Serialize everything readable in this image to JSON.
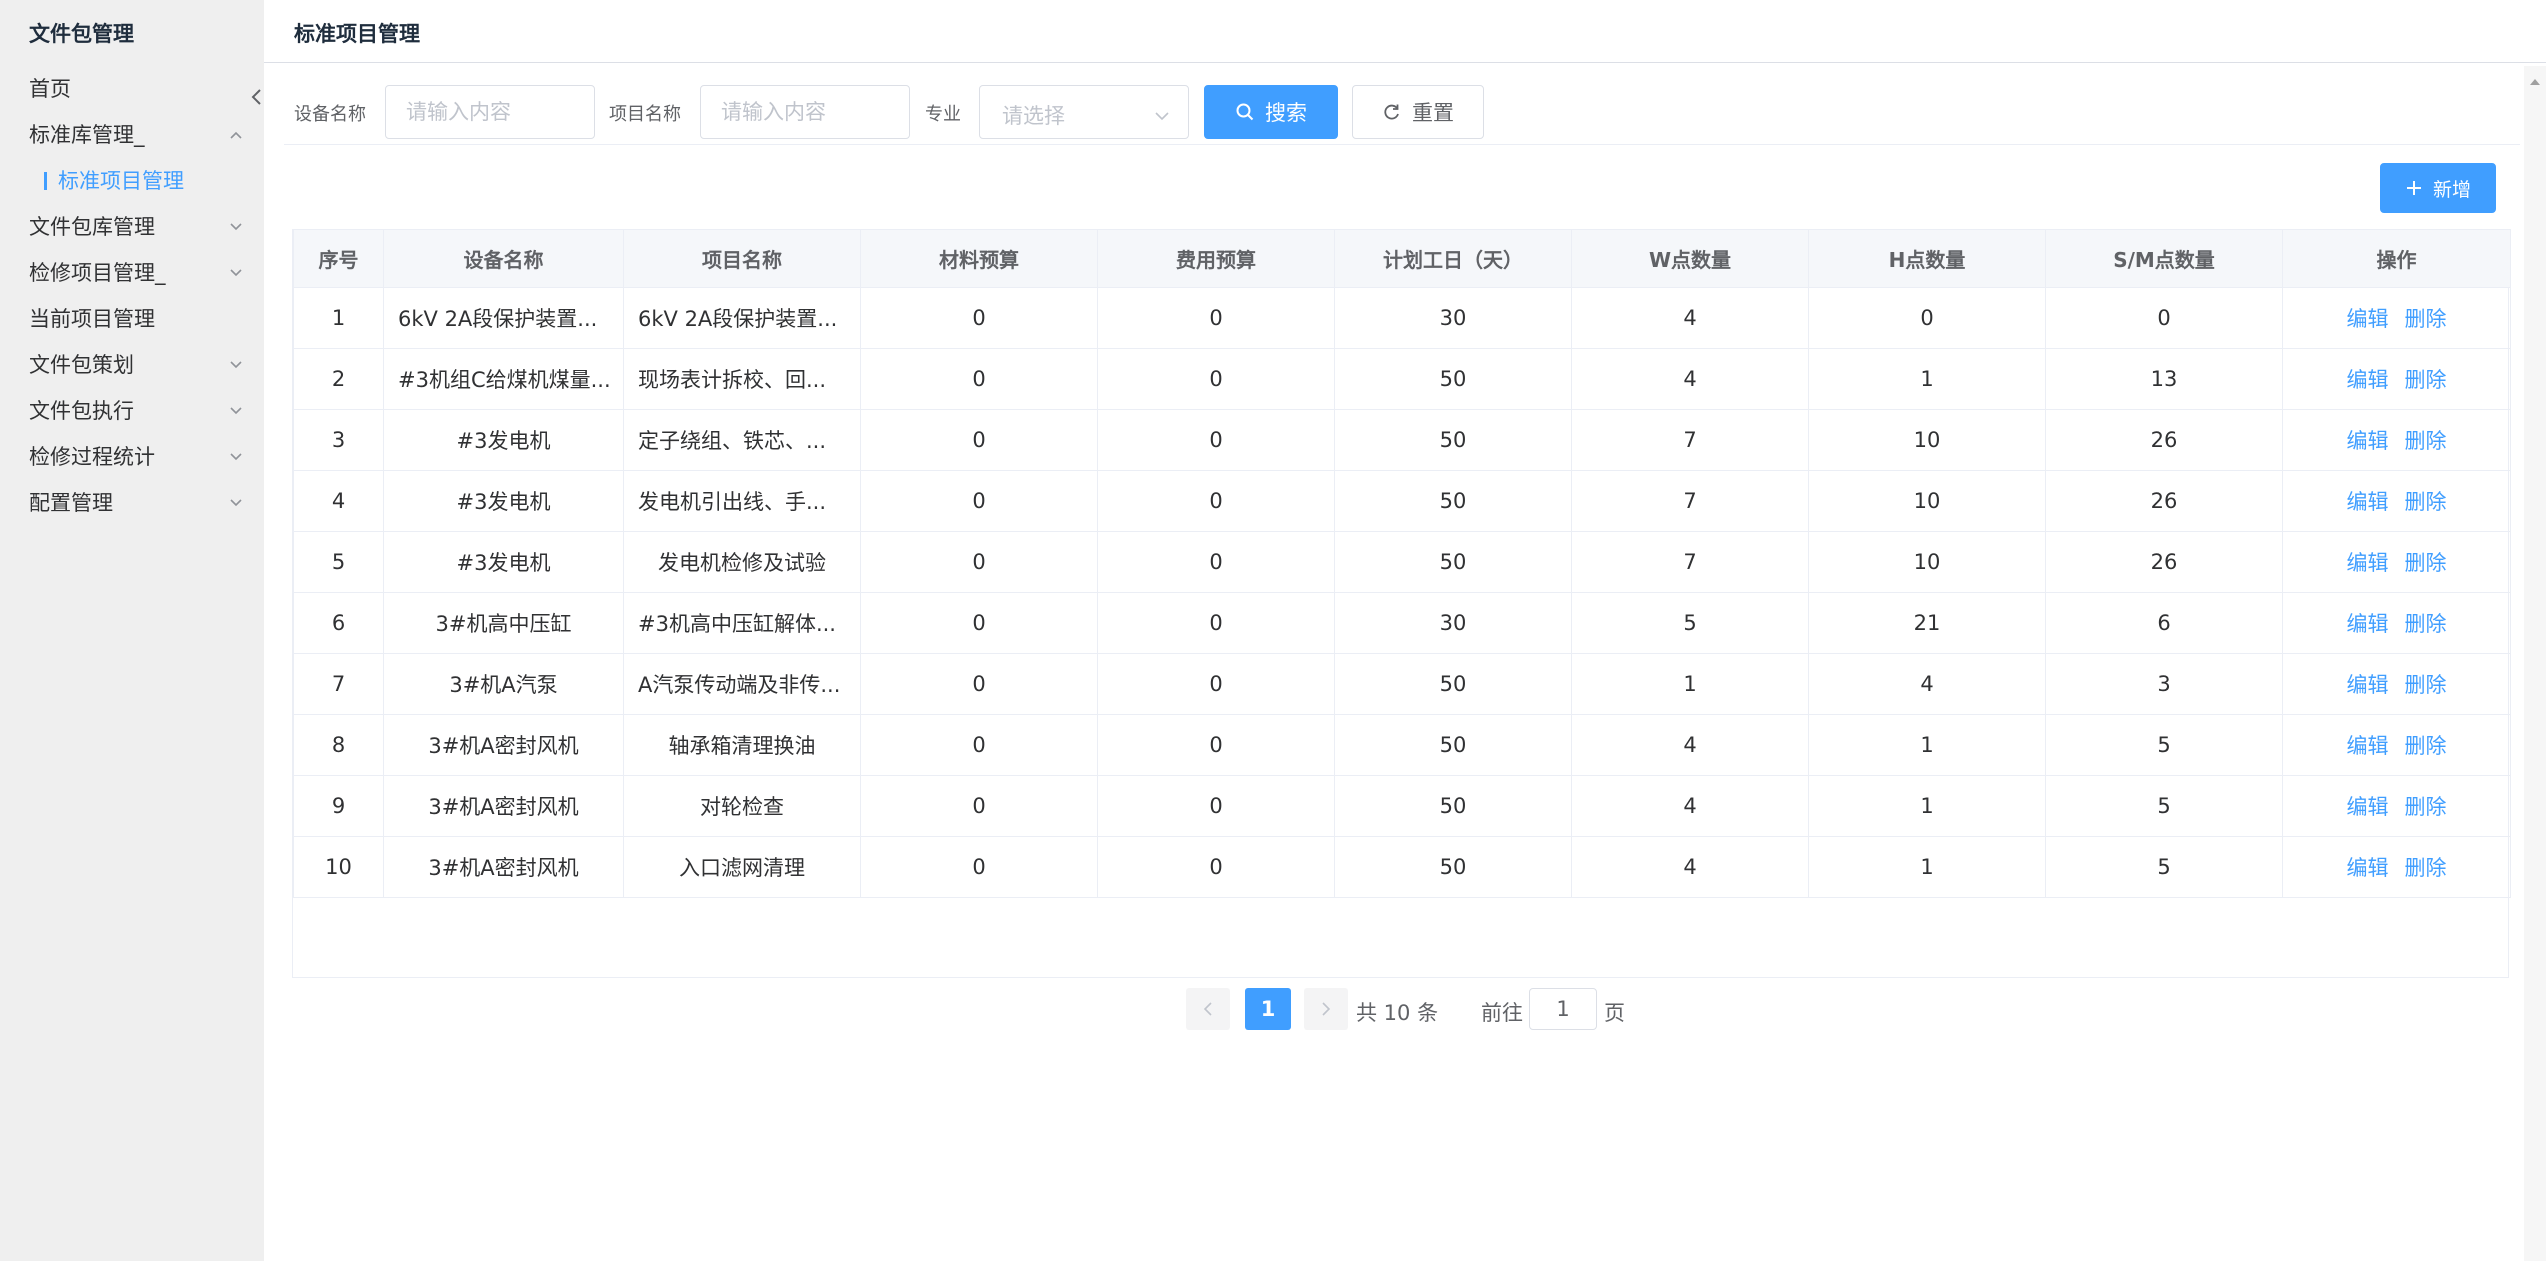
{
  "sidebar": {
    "brand": "文件包管理",
    "items": [
      {
        "label": "首页",
        "has_children": false
      },
      {
        "label": "标准库管理_",
        "has_children": true,
        "expanded": true,
        "children": [
          {
            "label": "标准项目管理",
            "active": true
          }
        ]
      },
      {
        "label": "文件包库管理",
        "has_children": true
      },
      {
        "label": "检修项目管理_",
        "has_children": true
      },
      {
        "label": "当前项目管理",
        "has_children": false
      },
      {
        "label": "文件包策划",
        "has_children": true
      },
      {
        "label": "文件包执行",
        "has_children": true
      },
      {
        "label": "检修过程统计",
        "has_children": true
      },
      {
        "label": "配置管理",
        "has_children": true
      }
    ]
  },
  "header": {
    "title": "标准项目管理"
  },
  "search": {
    "device_label": "设备名称",
    "device_placeholder": "请输入内容",
    "project_label": "项目名称",
    "project_placeholder": "请输入内容",
    "major_label": "专业",
    "major_placeholder": "请选择",
    "search_button": "搜索",
    "reset_button": "重置"
  },
  "toolbar": {
    "add_button": "新增"
  },
  "table": {
    "columns": [
      "序号",
      "设备名称",
      "项目名称",
      "材料预算",
      "费用预算",
      "计划工日（天）",
      "W点数量",
      "H点数量",
      "S/M点数量",
      "操作"
    ],
    "edit_label": "编辑",
    "delete_label": "删除",
    "rows": [
      [
        "1",
        "6kV 2A段保护装置...",
        "6kV 2A段保护装置...",
        "0",
        "0",
        "30",
        "4",
        "0",
        "0"
      ],
      [
        "2",
        "#3机组C给煤机煤量...",
        "现场表计拆校、回...",
        "0",
        "0",
        "50",
        "4",
        "1",
        "13"
      ],
      [
        "3",
        "#3发电机",
        "定子绕组、铁芯、...",
        "0",
        "0",
        "50",
        "7",
        "10",
        "26"
      ],
      [
        "4",
        "#3发电机",
        "发电机引出线、手...",
        "0",
        "0",
        "50",
        "7",
        "10",
        "26"
      ],
      [
        "5",
        "#3发电机",
        "发电机检修及试验",
        "0",
        "0",
        "50",
        "7",
        "10",
        "26"
      ],
      [
        "6",
        "3#机高中压缸",
        "#3机高中压缸解体...",
        "0",
        "0",
        "30",
        "5",
        "21",
        "6"
      ],
      [
        "7",
        "3#机A汽泵",
        "A汽泵传动端及非传...",
        "0",
        "0",
        "50",
        "1",
        "4",
        "3"
      ],
      [
        "8",
        "3#机A密封风机",
        "轴承箱清理换油",
        "0",
        "0",
        "50",
        "4",
        "1",
        "5"
      ],
      [
        "9",
        "3#机A密封风机",
        "对轮检查",
        "0",
        "0",
        "50",
        "4",
        "1",
        "5"
      ],
      [
        "10",
        "3#机A密封风机",
        "入口滤网清理",
        "0",
        "0",
        "50",
        "4",
        "1",
        "5"
      ]
    ]
  },
  "pagination": {
    "current_page": "1",
    "total_text": "共 10 条",
    "goto_label": "前往",
    "goto_value": "1",
    "page_suffix": "页"
  },
  "colors": {
    "primary": "#409eff",
    "sidebar_bg": "#efefef"
  }
}
